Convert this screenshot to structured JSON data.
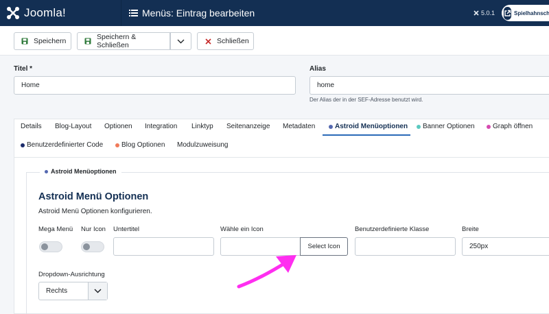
{
  "header": {
    "logo_text": "Joomla!",
    "page_title": "Menüs: Eintrag bearbeiten",
    "version": "5.0.1",
    "site_label": "Spielhahnschule"
  },
  "toolbar": {
    "save_label": "Speichern",
    "save_close_label": "Speichern & Schließen",
    "close_label": "Schließen"
  },
  "form": {
    "title_label": "Titel *",
    "title_value": "Home",
    "alias_label": "Alias",
    "alias_value": "home",
    "alias_hint": "Der Alias der in der SEF-Adresse benutzt wird."
  },
  "tabs": {
    "row1": [
      {
        "label": "Details"
      },
      {
        "label": "Blog-Layout"
      },
      {
        "label": "Optionen"
      },
      {
        "label": "Integration"
      },
      {
        "label": "Linktyp"
      },
      {
        "label": "Seitenanzeige"
      },
      {
        "label": "Metadaten"
      },
      {
        "label": "Astroid Menüoptionen",
        "dot_color": "#5468b0",
        "active": true
      },
      {
        "label": "Banner Optionen",
        "dot_color": "#5bc9c0"
      },
      {
        "label": "Graph öffnen",
        "dot_color": "#d64ab0"
      }
    ],
    "row2": [
      {
        "label": "Benutzerdefinierter Code",
        "dot_color": "#1b2b6b"
      },
      {
        "label": "Blog Optionen",
        "dot_color": "#f07a5a"
      },
      {
        "label": "Modulzuweisung"
      }
    ]
  },
  "panel": {
    "legend": "Astroid Menüoptionen",
    "title": "Astroid Menü Optionen",
    "description": "Astroid Menü Optionen konfigurieren.",
    "mega_menu_label": "Mega Menü",
    "icon_only_label": "Nur Icon",
    "subtitle_label": "Untertitel",
    "subtitle_value": "",
    "choose_icon_label": "Wähle ein Icon",
    "icon_value": "",
    "select_icon_button": "Select Icon",
    "custom_class_label": "Benutzerdefinierte Klasse",
    "custom_class_value": "",
    "width_label": "Breite",
    "width_value": "250px",
    "dropdown_label": "Dropdown-Ausrichtung",
    "dropdown_value": "Rechts",
    "mega_menu_on": false,
    "icon_only_on": false
  },
  "colors": {
    "header_bg": "#132f53",
    "accent": "#2a69b8",
    "annotation_arrow": "#ff2ef0"
  }
}
